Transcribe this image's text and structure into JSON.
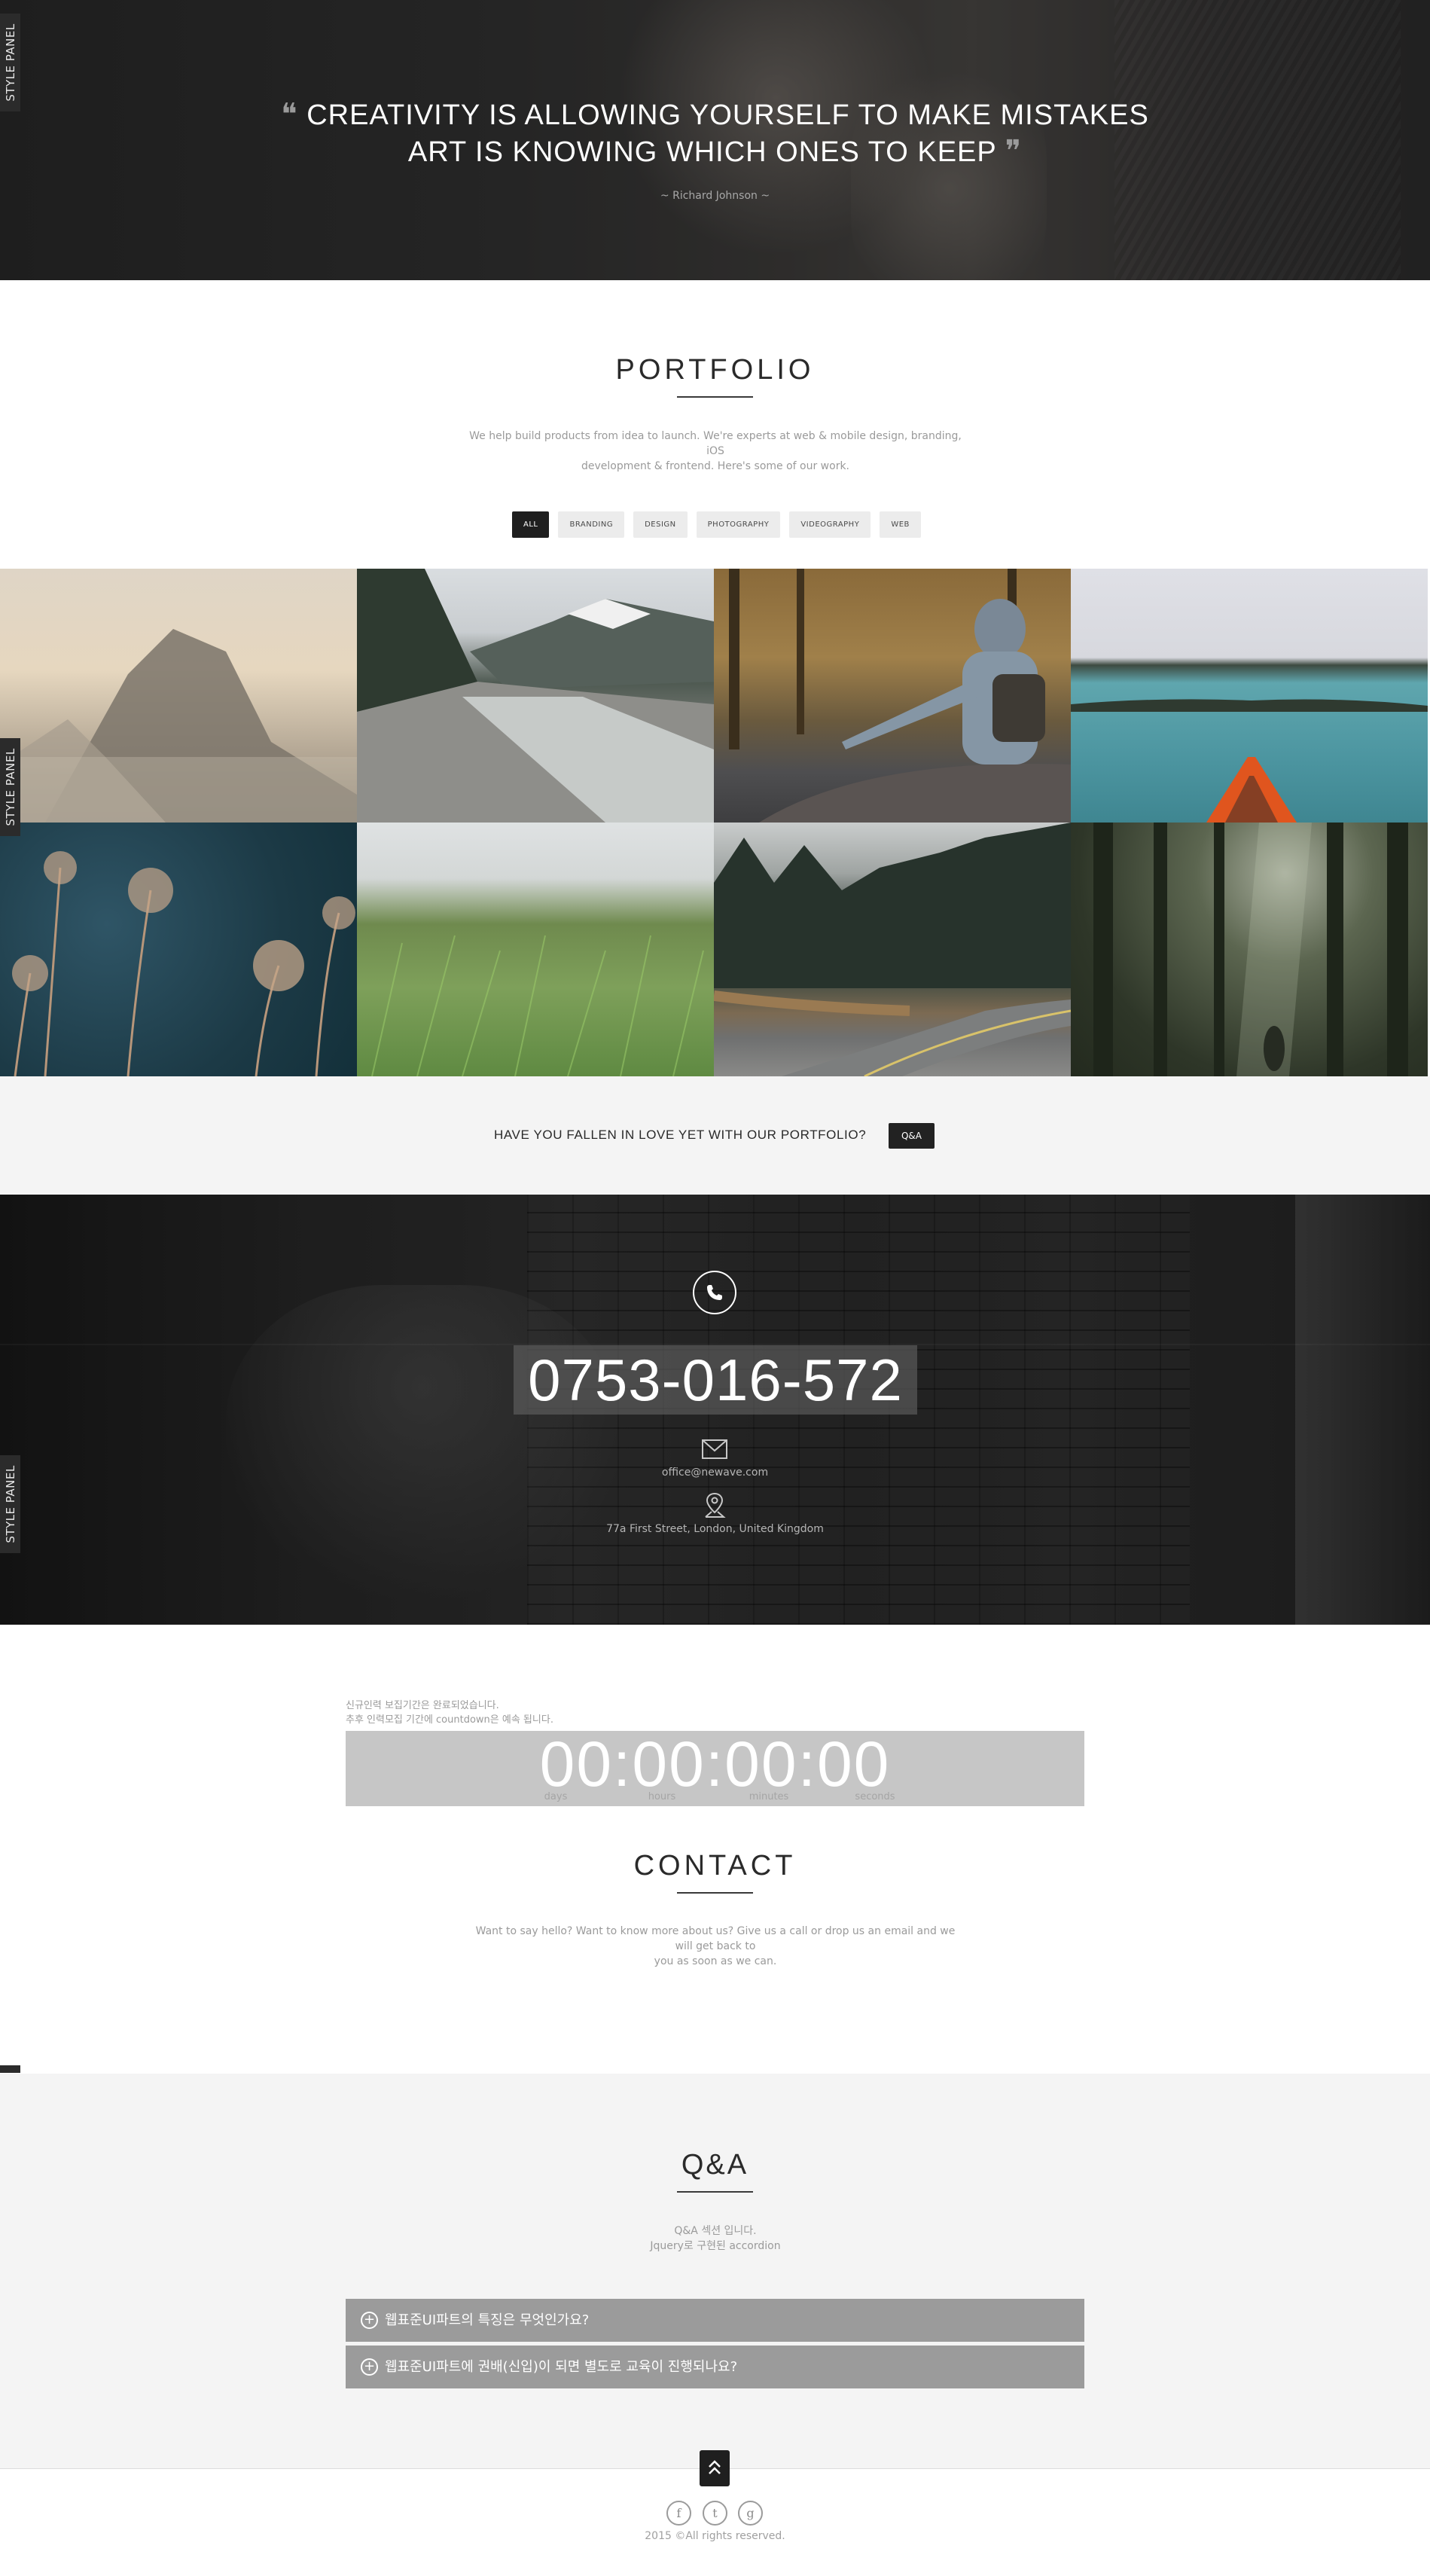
{
  "style_panel_label": "STYLE PANEL",
  "hero": {
    "quote_open": "❝",
    "quote_line1": "CREATIVITY IS ALLOWING YOURSELF TO MAKE MISTAKES",
    "quote_line2": "ART IS KNOWING WHICH ONES TO KEEP",
    "quote_close": "❞",
    "author": "~ Richard Johnson ~"
  },
  "portfolio": {
    "title": "PORTFOLIO",
    "desc_line1": "We help build products from idea to launch. We're experts at web & mobile design, branding, iOS",
    "desc_line2": "development & frontend. Here's some of our work.",
    "filters": [
      "ALL",
      "BRANDING",
      "DESIGN",
      "PHOTOGRAPHY",
      "VIDEOGRAPHY",
      "WEB"
    ],
    "active_filter": "ALL",
    "cta_text": "HAVE YOU FALLEN IN LOVE YET WITH OUR PORTFOLIO?",
    "cta_button": "Q&A"
  },
  "contact_info": {
    "phone": "0753-016-572",
    "email": "office@newave.com",
    "address": "77a First Street, London, United Kingdom"
  },
  "countdown": {
    "note_line1": "신규인력 보집기간은 완료되었습니다.",
    "note_line2": "추후 인력모집 기간에 countdown은 예속 됩니다.",
    "days": "00",
    "hours": "00",
    "minutes": "00",
    "seconds": "00",
    "label_days": "days",
    "label_hours": "hours",
    "label_minutes": "minutes",
    "label_seconds": "seconds"
  },
  "contact": {
    "title": "CONTACT",
    "desc_line1": "Want to say hello? Want to know more about us? Give us a call or drop us an email and we will get back to",
    "desc_line2": "you as soon as we can."
  },
  "qa": {
    "title": "Q&A",
    "desc_line1": "Q&A 섹션 입니다.",
    "desc_line2": "Jquery로 구현된 accordion",
    "items": [
      "웹표준UI파트의 특징은 무엇인가요?",
      "웹표준UI파트에 권배(신입)이 되면 별도로 교육이 진행되나요?"
    ]
  },
  "footer": {
    "social": [
      "f",
      "t",
      "g"
    ],
    "copyright": "2015 ©All rights reserved."
  },
  "colors": {
    "dark": "#1f1f1f",
    "accordion": "#9b9b9b",
    "countdown_box": "#c6c6c6",
    "light_bg": "#f4f4f4"
  }
}
